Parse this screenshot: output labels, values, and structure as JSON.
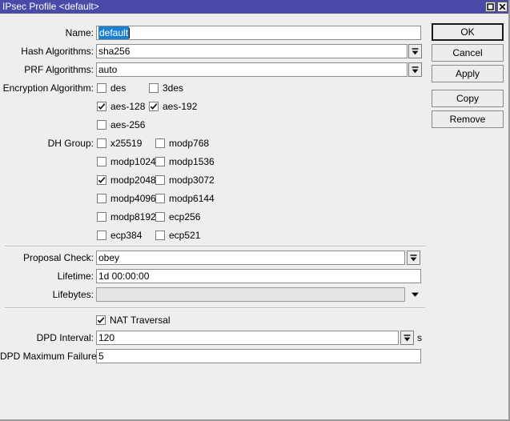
{
  "window": {
    "title": "IPsec Profile <default>",
    "titlebar_buttons": [
      {
        "name": "maximize-button",
        "icon": "square-icon",
        "label": ""
      },
      {
        "name": "close-button",
        "icon": "close-icon",
        "label": ""
      }
    ],
    "colors": {
      "titlebar": "#4a4aa8",
      "window_bg": "#eeeeee",
      "selection": "#1d7fd1",
      "field_bg": "#ffffff",
      "field_disabled_bg": "#e4e4e4",
      "border": "#8c8c8c"
    }
  },
  "form": {
    "name": {
      "label": "Name:",
      "value": "default",
      "placeholder": "",
      "selected": true
    },
    "hash_algorithms": {
      "label": "Hash Algorithms:",
      "value": "sha256",
      "placeholder": "",
      "dropdown_icon": "dropdown-arrow-icon"
    },
    "prf_algorithms": {
      "label": "PRF Algorithms:",
      "value": "auto",
      "placeholder": "",
      "dropdown_icon": "dropdown-arrow-icon"
    },
    "encryption_algorithm": {
      "label": "Encryption Algorithm:",
      "options": [
        {
          "label": "des",
          "checked": false
        },
        {
          "label": "3des",
          "checked": false
        },
        {
          "label": "aes-128",
          "checked": true
        },
        {
          "label": "aes-192",
          "checked": true
        },
        {
          "label": "aes-256",
          "checked": false
        }
      ]
    },
    "dh_group": {
      "label": "DH Group:",
      "options": [
        {
          "label": "x25519",
          "checked": false
        },
        {
          "label": "modp768",
          "checked": false
        },
        {
          "label": "modp1024",
          "checked": false
        },
        {
          "label": "modp1536",
          "checked": false
        },
        {
          "label": "modp2048",
          "checked": true
        },
        {
          "label": "modp3072",
          "checked": false
        },
        {
          "label": "modp4096",
          "checked": false
        },
        {
          "label": "modp6144",
          "checked": false
        },
        {
          "label": "modp8192",
          "checked": false
        },
        {
          "label": "ecp256",
          "checked": false
        },
        {
          "label": "ecp384",
          "checked": false
        },
        {
          "label": "ecp521",
          "checked": false
        }
      ]
    },
    "proposal_check": {
      "label": "Proposal Check:",
      "value": "obey",
      "placeholder": "",
      "dropdown_icon": "dropdown-arrow-icon"
    },
    "lifetime": {
      "label": "Lifetime:",
      "value": "1d 00:00:00",
      "placeholder": ""
    },
    "lifebytes": {
      "label": "Lifebytes:",
      "value": "",
      "placeholder": "",
      "disabled": true,
      "dropdown_icon": "chevron-down-icon"
    },
    "nat_traversal": {
      "label": "NAT Traversal",
      "checked": true
    },
    "dpd_interval": {
      "label": "DPD Interval:",
      "value": "120",
      "placeholder": "",
      "unit": "s",
      "dropdown_icon": "dropdown-arrow-icon"
    },
    "dpd_maximum_failures": {
      "label": "DPD Maximum Failures:",
      "value": "5",
      "placeholder": ""
    }
  },
  "buttons": [
    {
      "name": "ok-button",
      "label": "OK",
      "default": true
    },
    {
      "name": "cancel-button",
      "label": "Cancel",
      "default": false
    },
    {
      "name": "apply-button",
      "label": "Apply",
      "default": false
    },
    {
      "name": "copy-button",
      "label": "Copy",
      "default": false
    },
    {
      "name": "remove-button",
      "label": "Remove",
      "default": false
    }
  ]
}
